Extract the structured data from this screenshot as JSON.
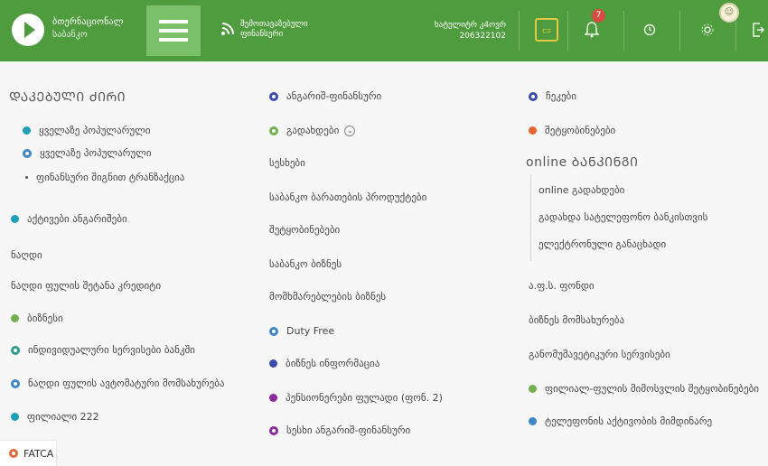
{
  "header": {
    "logo_name": "ბთერნაციონალ",
    "logo_sub": "საბანკო",
    "services": [
      "შემოთავაზებული",
      "ფინანსური"
    ],
    "user_name": "ხატულიტრ კ4ოვრ",
    "user_id": "206322102",
    "notification_count": "7",
    "card_label": "▭",
    "avatar_label": "☺"
  },
  "colors": {
    "header_green": "#4e9c3e",
    "menu_green": "#7bc16a",
    "teal": "#1e9fb4",
    "blue": "#3d87c9",
    "green": "#72b04d",
    "navy": "#3a4caf",
    "purple": "#8b2b9c",
    "orange": "#e8622c"
  },
  "col1": {
    "title": "ᲓᲐᲙᲔᲑᲣᲚᲘ ᲫᲘᲠᲘ",
    "items": [
      {
        "label": "ყველაზე პოპულარული",
        "marker": "dot",
        "color": "#1e9fb4"
      },
      {
        "label": "ყველაზე პოპულარული",
        "marker": "ring",
        "color": "#3d87c9"
      },
      {
        "label": "ფინანსური შიგნით ტრანზაქცია",
        "marker": "bullet",
        "color": "#555"
      },
      {
        "label": "აქტივები ანგარიშები",
        "marker": "dot",
        "color": "#1e9fb4"
      },
      {
        "label": "ნაღდი",
        "marker": "none",
        "color": ""
      },
      {
        "label": "ნაღდი ფულის შეტანა კრედიტი",
        "marker": "none",
        "color": ""
      },
      {
        "label": "ბიზნესი",
        "marker": "dot",
        "color": "#72b04d"
      },
      {
        "label": "ინდივიდუალური სერვისები ბანკში",
        "marker": "ring",
        "color": "#2f9e8e"
      },
      {
        "label": "ნაღდი ფულის ავტომატური მომსახურება",
        "marker": "ring",
        "color": "#3d87c9"
      },
      {
        "label": "ფილიალი 222",
        "marker": "dot",
        "color": "#1e9fb4"
      }
    ]
  },
  "col2": {
    "items": [
      {
        "label": "ანგარიშ-ფინანსური",
        "marker": "ring",
        "color": "#3a4caf"
      },
      {
        "label": "გადახდები",
        "marker": "ring",
        "color": "#72b04d",
        "chevron": "⌄"
      },
      {
        "label": "სესხები",
        "marker": "none",
        "color": ""
      },
      {
        "label": "საბანკო ბარათების პროდუქტები",
        "marker": "none",
        "color": ""
      },
      {
        "label": "შეტყობინებები",
        "marker": "none",
        "color": ""
      },
      {
        "label": "საბანკო ბიზნეს",
        "marker": "none",
        "color": ""
      },
      {
        "label": "მომხმარებლების ბიზნეს",
        "marker": "none",
        "color": ""
      },
      {
        "label": "Duty Free",
        "marker": "ring",
        "color": "#3d87c9"
      },
      {
        "label": "ბიზნეს ინფორმაცია",
        "marker": "dot",
        "color": "#3a4caf"
      },
      {
        "label": "პენსიონერები ფულადი (ფონ. 2)",
        "marker": "dot",
        "color": "#8b2b9c"
      },
      {
        "label": "სესხი ანგარიშ-ფინანსური",
        "marker": "ring",
        "color": "#8b2b9c"
      }
    ]
  },
  "col3": {
    "items": [
      {
        "label": "ჩეკები",
        "marker": "ring",
        "color": "#3a4caf"
      },
      {
        "label": "შეტყობინებები",
        "marker": "dot",
        "color": "#e8622c"
      }
    ],
    "online_title": "online ᲑᲐᲜᲙᲘᲜᲒᲘ",
    "online_items": [
      "online გადახდები",
      "გადახდა სატელეფონო ბანკისთვის",
      "ელექტრონული განაცხადი"
    ],
    "items_after": [
      {
        "label": "ა.ფ.ს. ფონდი",
        "marker": "none",
        "color": ""
      },
      {
        "label": "ბიზნეს მომსახურება",
        "marker": "none",
        "color": ""
      },
      {
        "label": "განომუშავეტიკური სერვისები",
        "marker": "none",
        "color": ""
      },
      {
        "label": "ფილიალ-ფულის მიმოსვლის შეტყობინებები",
        "marker": "dot",
        "color": "#72b04d"
      },
      {
        "label": "ტელეფონის აქტივობის მიმდინარე",
        "marker": "dot",
        "color": "#3d87c9"
      }
    ]
  },
  "footer": {
    "fatca_label": "FATCA"
  }
}
